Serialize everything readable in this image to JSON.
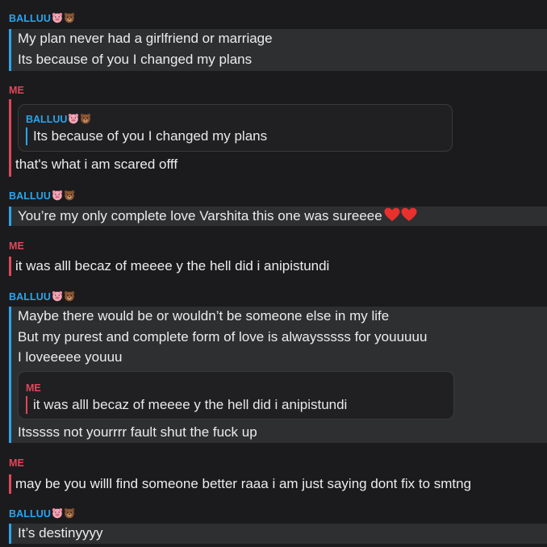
{
  "contacts": {
    "balluu": "BALLUU",
    "me": "ME"
  },
  "colors": {
    "balluu": "#2aa5ee",
    "me": "#e0475a",
    "background": "#1b1b1d",
    "highlight": "#2e2f31"
  },
  "icons": {
    "balluu_emoji": [
      "pig-face-icon",
      "bear-face-icon"
    ],
    "heart_emoji": "red-heart-icon"
  },
  "messages": [
    {
      "sender": "BALLUU",
      "lines": [
        "My plan never had a girlfriend or marriage",
        "Its because of you I changed my plans"
      ]
    },
    {
      "sender": "ME",
      "quote": {
        "sender": "BALLUU",
        "text": "Its because of you I changed my plans"
      },
      "lines": [
        "that's what i am scared offf"
      ]
    },
    {
      "sender": "BALLUU",
      "lines": [
        "You’re my only complete love Varshita this one was sureeee"
      ]
    },
    {
      "sender": "ME",
      "lines": [
        "it was alll becaz of meeee y the hell did i anipistundi"
      ]
    },
    {
      "sender": "BALLUU",
      "lines": [
        "Maybe there would be or wouldn’t be someone else in my life",
        "But my purest and complete form of love is alwaysssss for youuuuu",
        "I loveeeee youuu"
      ],
      "quote": {
        "sender": "ME",
        "text": "it was alll becaz of meeee y the hell did i anipistundi"
      },
      "after_quote": "Itsssss not yourrrr fault shut the fuck up"
    },
    {
      "sender": "ME",
      "lines": [
        "may be you willl find someone better raaa i am just saying dont fix to smtng"
      ]
    },
    {
      "sender": "BALLUU",
      "lines": [
        "It’s destinyyyy"
      ]
    }
  ]
}
